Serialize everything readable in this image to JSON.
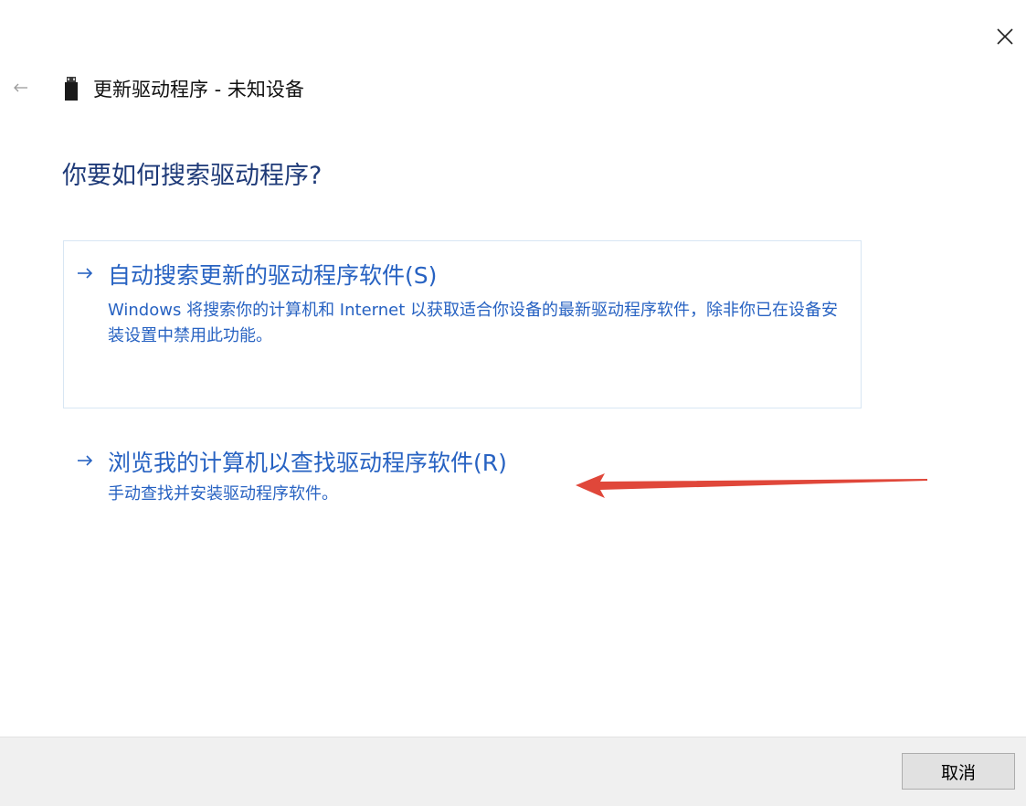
{
  "window": {
    "close_icon": "close-icon",
    "back_icon": "back-arrow-icon"
  },
  "header": {
    "device_icon": "usb-device-icon",
    "title": "更新驱动程序 - 未知设备"
  },
  "heading": "你要如何搜索驱动程序?",
  "options": [
    {
      "icon": "arrow-right-icon",
      "title": "自动搜索更新的驱动程序软件(S)",
      "description": "Windows 将搜索你的计算机和 Internet 以获取适合你设备的最新驱动程序软件，除非你已在设备安装设置中禁用此功能。"
    },
    {
      "icon": "arrow-right-icon",
      "title": "浏览我的计算机以查找驱动程序软件(R)",
      "description": "手动查找并安装驱动程序软件。"
    }
  ],
  "footer": {
    "cancel_label": "取消"
  },
  "colors": {
    "link": "#2762c2",
    "heading": "#1e3a78",
    "annotation_arrow": "#e0473a",
    "option_border": "#d8e6f3",
    "footer_bg": "#f0f0f0"
  }
}
